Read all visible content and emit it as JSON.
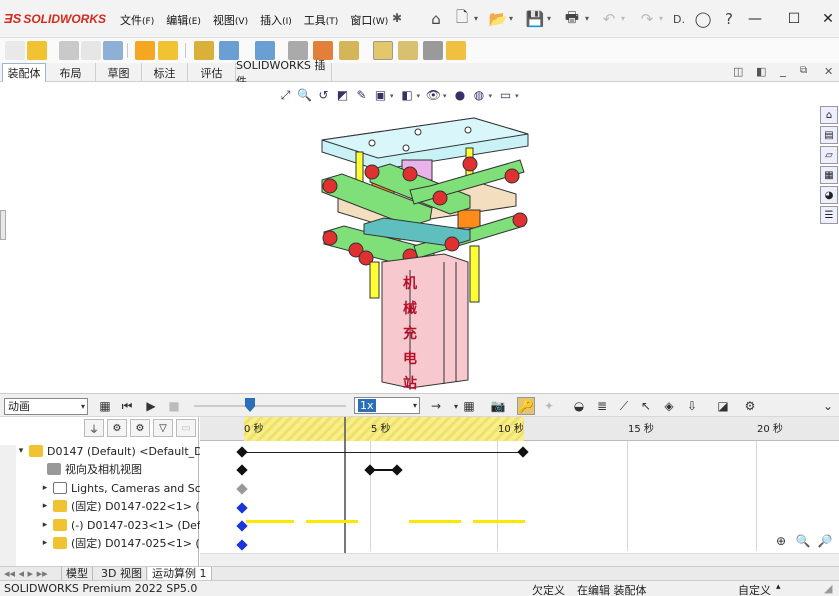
{
  "app": {
    "logo_text": "SOLIDWORKS",
    "logo_ds": "3S"
  },
  "menu": [
    {
      "label": "文件",
      "acc": "(F)"
    },
    {
      "label": "编辑",
      "acc": "(E)"
    },
    {
      "label": "视图",
      "acc": "(V)"
    },
    {
      "label": "插入",
      "acc": "(I)"
    },
    {
      "label": "工具",
      "acc": "(T)"
    },
    {
      "label": "窗口",
      "acc": "(W)"
    }
  ],
  "title_toolbar": {
    "search_stub": "D."
  },
  "tabs": [
    "装配体",
    "布局",
    "草图",
    "标注",
    "评估",
    "SOLIDWORKS 插件"
  ],
  "motion": {
    "study_type": "动画",
    "playback_speed": "1x"
  },
  "tree": {
    "rows": [
      {
        "label": "D0147 (Default) <Default_Dis",
        "icon": "assembly-icon"
      },
      {
        "label": "视向及相机视图",
        "icon": "camera-view-icon"
      },
      {
        "label": "Lights, Cameras and Sce",
        "icon": "lights-folder-icon"
      },
      {
        "label": "(固定) D0147-022<1> (D",
        "icon": "part-icon"
      },
      {
        "label": "(-) D0147-023<1> (Defa",
        "icon": "part-icon"
      },
      {
        "label": "(固定) D0147-025<1> (D",
        "icon": "part-icon"
      }
    ]
  },
  "timeline": {
    "ticks": [
      {
        "label": "0 秒",
        "seconds": 0
      },
      {
        "label": "5 秒",
        "seconds": 5
      },
      {
        "label": "10 秒",
        "seconds": 10
      },
      {
        "label": "15 秒",
        "seconds": 15
      },
      {
        "label": "20 秒",
        "seconds": 20
      }
    ],
    "current_time_seconds": 4
  },
  "bottom_tabs": [
    "模型",
    "3D 视图",
    "运动算例 1"
  ],
  "status": {
    "product": "SOLIDWORKS Premium 2022 SP5.0",
    "undefined": "欠定义",
    "editing": "在编辑 装配体",
    "custom": "自定义"
  },
  "colors": {
    "accent_blue": "#2a6fb8",
    "timeline_yellow": "#ffe800",
    "plate_cyan": "#c8f2f6",
    "link_green": "#7fe07a",
    "pillar_pink": "#f7c9cf",
    "text_red": "#b5102a"
  },
  "pillar_text": [
    "机",
    "械",
    "充",
    "电",
    "站"
  ]
}
